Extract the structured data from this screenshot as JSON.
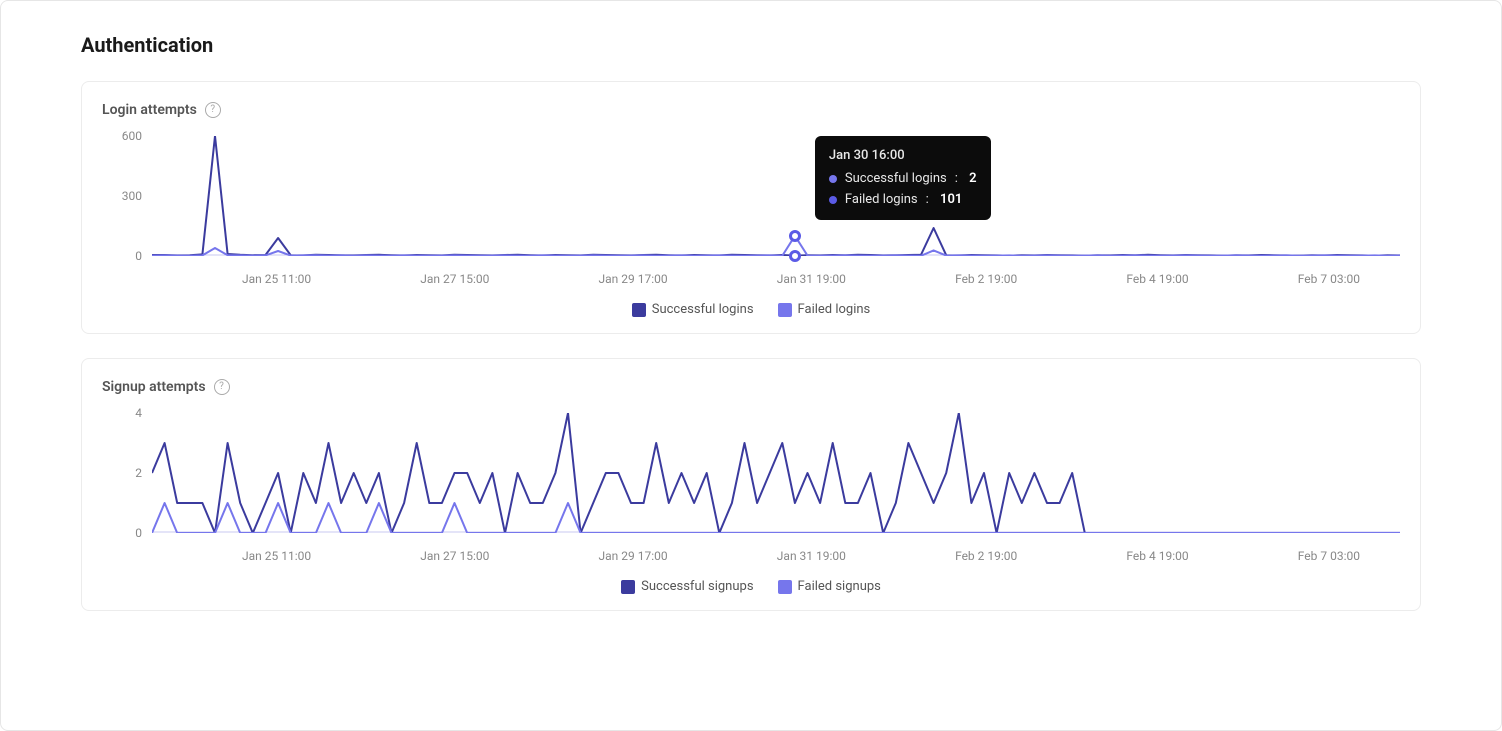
{
  "page": {
    "title": "Authentication"
  },
  "colors": {
    "series_a": "#3b3b9e",
    "series_b": "#7676ec",
    "accent": "#5b5be6"
  },
  "x_labels": [
    "Jan 25 11:00",
    "Jan 27 15:00",
    "Jan 29 17:00",
    "Jan 31 19:00",
    "Feb 2 19:00",
    "Feb 4 19:00",
    "Feb 7 03:00"
  ],
  "tooltip": {
    "time": "Jan 30 16:00",
    "rows": [
      {
        "label": "Successful logins",
        "value": 2,
        "color": "#7676ec"
      },
      {
        "label": "Failed logins",
        "value": 101,
        "color": "#5b5be6"
      }
    ]
  },
  "chart_data": [
    {
      "id": "logins",
      "type": "line",
      "title": "Login attempts",
      "ylim": [
        0,
        600
      ],
      "y_ticks": [
        0,
        300,
        600
      ],
      "legend": [
        {
          "name": "Successful logins",
          "color": "#3b3b9e"
        },
        {
          "name": "Failed logins",
          "color": "#7676ec"
        }
      ],
      "series": [
        {
          "name": "Successful logins",
          "color": "#3b3b9e",
          "values": [
            5,
            5,
            3,
            4,
            8,
            600,
            10,
            6,
            4,
            5,
            90,
            4,
            3,
            6,
            5,
            4,
            3,
            5,
            6,
            4,
            3,
            5,
            4,
            3,
            6,
            5,
            4,
            3,
            5,
            6,
            4,
            3,
            5,
            4,
            3,
            6,
            5,
            4,
            3,
            5,
            6,
            4,
            3,
            5,
            4,
            3,
            6,
            5,
            4,
            3,
            5,
            2,
            4,
            3,
            5,
            4,
            6,
            5,
            3,
            4,
            5,
            6,
            140,
            4,
            3,
            5,
            4,
            3,
            2,
            4,
            3,
            5,
            4,
            3,
            2,
            4,
            3,
            5,
            4,
            6,
            4,
            3,
            5,
            4,
            3,
            2,
            4,
            3,
            5,
            4,
            3,
            2,
            4,
            3,
            5,
            4,
            3,
            2,
            4,
            3
          ]
        },
        {
          "name": "Failed logins",
          "color": "#7676ec",
          "values": [
            2,
            3,
            2,
            1,
            3,
            40,
            4,
            3,
            2,
            3,
            25,
            2,
            3,
            4,
            2,
            3,
            1,
            3,
            2,
            1,
            3,
            2,
            1,
            2,
            3,
            2,
            1,
            2,
            3,
            2,
            1,
            3,
            2,
            1,
            2,
            3,
            2,
            1,
            2,
            3,
            1,
            2,
            3,
            1,
            2,
            3,
            2,
            1,
            2,
            3,
            1,
            101,
            2,
            1,
            2,
            3,
            2,
            1,
            2,
            3,
            2,
            1,
            28,
            2,
            3,
            2,
            1,
            2,
            3,
            1,
            2,
            3,
            2,
            1,
            2,
            3,
            1,
            2,
            3,
            2,
            1,
            2,
            3,
            2,
            1,
            2,
            3,
            2,
            1,
            2,
            3,
            1,
            2,
            3,
            2,
            1,
            2,
            3,
            1,
            2
          ]
        }
      ],
      "hover_index": 51
    },
    {
      "id": "signups",
      "type": "line",
      "title": "Signup attempts",
      "ylim": [
        0,
        4
      ],
      "y_ticks": [
        0,
        2,
        4
      ],
      "legend": [
        {
          "name": "Successful signups",
          "color": "#3b3b9e"
        },
        {
          "name": "Failed signups",
          "color": "#7676ec"
        }
      ],
      "series": [
        {
          "name": "Successful signups",
          "color": "#3b3b9e",
          "values": [
            2,
            3,
            1,
            1,
            1,
            0,
            3,
            1,
            0,
            1,
            2,
            0,
            2,
            1,
            3,
            1,
            2,
            1,
            2,
            0,
            1,
            3,
            1,
            1,
            2,
            2,
            1,
            2,
            0,
            2,
            1,
            1,
            2,
            4,
            0,
            1,
            2,
            2,
            1,
            1,
            3,
            1,
            2,
            1,
            2,
            0,
            1,
            3,
            1,
            2,
            3,
            1,
            2,
            1,
            3,
            1,
            1,
            2,
            0,
            1,
            3,
            2,
            1,
            2,
            4,
            1,
            2,
            0,
            2,
            1,
            2,
            1,
            1,
            2,
            0,
            0,
            0,
            0,
            0,
            0,
            0,
            0,
            0,
            0,
            0,
            0,
            0,
            0,
            0,
            0,
            0,
            0,
            0,
            0,
            0,
            0,
            0,
            0,
            0,
            0
          ]
        },
        {
          "name": "Failed signups",
          "color": "#7676ec",
          "values": [
            0,
            1,
            0,
            0,
            0,
            0,
            1,
            0,
            0,
            0,
            1,
            0,
            0,
            0,
            1,
            0,
            0,
            0,
            1,
            0,
            0,
            0,
            0,
            0,
            1,
            0,
            0,
            0,
            0,
            0,
            0,
            0,
            0,
            1,
            0,
            0,
            0,
            0,
            0,
            0,
            0,
            0,
            0,
            0,
            0,
            0,
            0,
            0,
            0,
            0,
            0,
            0,
            0,
            0,
            0,
            0,
            0,
            0,
            0,
            0,
            0,
            0,
            0,
            0,
            0,
            0,
            0,
            0,
            0,
            0,
            0,
            0,
            0,
            0,
            0,
            0,
            0,
            0,
            0,
            0,
            0,
            0,
            0,
            0,
            0,
            0,
            0,
            0,
            0,
            0,
            0,
            0,
            0,
            0,
            0,
            0,
            0,
            0,
            0,
            0
          ]
        }
      ]
    }
  ]
}
